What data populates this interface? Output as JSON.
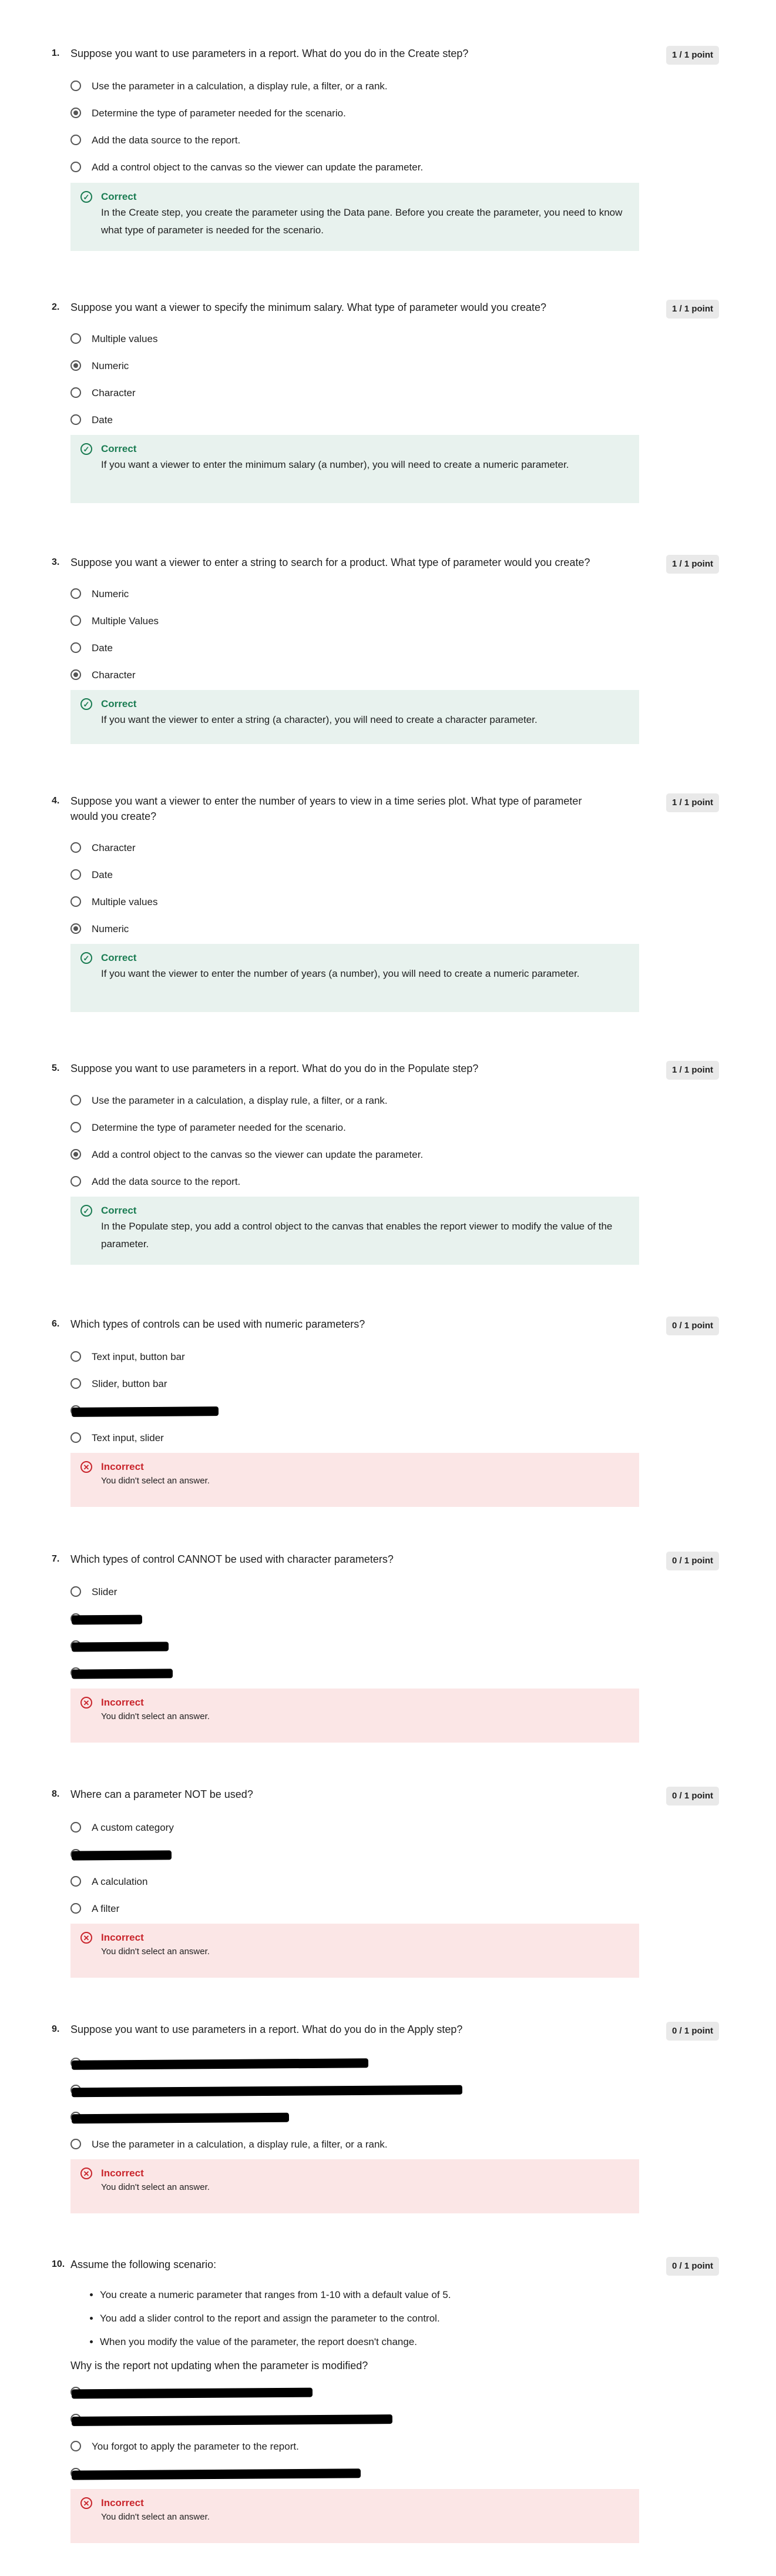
{
  "questions": [
    {
      "number": "1.",
      "text": "Suppose you want to use parameters in a report. What do you do in the Create step?",
      "score": "1 / 1 point",
      "options": [
        {
          "label": "Use the parameter in a calculation, a display rule, a filter, or a rank.",
          "selected": false
        },
        {
          "label": "Determine the type of parameter needed for the scenario.",
          "selected": true
        },
        {
          "label": "Add the data source to the report.",
          "selected": false
        },
        {
          "label": "Add a control object to the canvas so the viewer can update the parameter.",
          "selected": false
        }
      ],
      "feedback": {
        "status": "correct",
        "title": "Correct",
        "text": "In the Create step, you create the parameter using the Data pane. Before you create the parameter, you need to know what type of parameter is needed for the scenario."
      }
    },
    {
      "number": "2.",
      "text": "Suppose you want a viewer to specify the minimum salary. What type of parameter would you create?",
      "score": "1 / 1 point",
      "options": [
        {
          "label": "Multiple values",
          "selected": false
        },
        {
          "label": "Numeric",
          "selected": true
        },
        {
          "label": "Character",
          "selected": false
        },
        {
          "label": "Date",
          "selected": false
        }
      ],
      "feedback": {
        "status": "correct",
        "title": "Correct",
        "text": "If you want a viewer to enter the minimum salary (a number), you will need to create a numeric parameter."
      }
    },
    {
      "number": "3.",
      "text": "Suppose you want a viewer to enter a string to search for a product. What type of parameter would you create?",
      "score": "1 / 1 point",
      "options": [
        {
          "label": "Numeric",
          "selected": false
        },
        {
          "label": "Multiple Values",
          "selected": false
        },
        {
          "label": "Date",
          "selected": false
        },
        {
          "label": "Character",
          "selected": true
        }
      ],
      "feedback": {
        "status": "correct",
        "title": "Correct",
        "text": "If you want the viewer to enter a string (a character), you will need to create a character parameter."
      }
    },
    {
      "number": "4.",
      "text": "Suppose you want a viewer to enter the number of years to view in a time series plot. What type of parameter would you create?",
      "score": "1 / 1 point",
      "options": [
        {
          "label": "Character",
          "selected": false
        },
        {
          "label": "Date",
          "selected": false
        },
        {
          "label": "Multiple values",
          "selected": false
        },
        {
          "label": "Numeric",
          "selected": true
        }
      ],
      "feedback": {
        "status": "correct",
        "title": "Correct",
        "text": "If you want the viewer to enter the number of years (a number), you will need to create a numeric parameter."
      }
    },
    {
      "number": "5.",
      "text": "Suppose you want to use parameters in a report. What do you do in the Populate step?",
      "score": "1 / 1 point",
      "options": [
        {
          "label": "Use the parameter in a calculation, a display rule, a filter, or a rank.",
          "selected": false
        },
        {
          "label": "Determine the type of parameter needed for the scenario.",
          "selected": false
        },
        {
          "label": "Add a control object to the canvas so the viewer can update the parameter.",
          "selected": true
        },
        {
          "label": "Add the data source to the report.",
          "selected": false
        }
      ],
      "feedback": {
        "status": "correct",
        "title": "Correct",
        "text": "In the Populate step, you add a control object to the canvas that enables the report viewer to modify the value of the parameter."
      }
    },
    {
      "number": "6.",
      "text": "Which types of controls can be used with numeric parameters?",
      "score": "0 / 1 point",
      "options": [
        {
          "label": "Text input, button bar",
          "selected": false
        },
        {
          "label": "Slider, button bar",
          "selected": false
        },
        {
          "label": "",
          "selected": false
        },
        {
          "label": "Text input, slider",
          "selected": false
        }
      ],
      "feedback": {
        "status": "incorrect",
        "title": "Incorrect",
        "text": "You didn't select an answer."
      }
    },
    {
      "number": "7.",
      "text": "Which types of control CANNOT be used with character parameters?",
      "score": "0 / 1 point",
      "options": [
        {
          "label": "Slider",
          "selected": false
        },
        {
          "label": "",
          "selected": false
        },
        {
          "label": "",
          "selected": false
        },
        {
          "label": "",
          "selected": false
        }
      ],
      "feedback": {
        "status": "incorrect",
        "title": "Incorrect",
        "text": "You didn't select an answer."
      }
    },
    {
      "number": "8.",
      "text": "Where can a parameter NOT be used?",
      "score": "0 / 1 point",
      "options": [
        {
          "label": "A custom category",
          "selected": false
        },
        {
          "label": "",
          "selected": false
        },
        {
          "label": "A calculation",
          "selected": false
        },
        {
          "label": "A filter",
          "selected": false
        }
      ],
      "feedback": {
        "status": "incorrect",
        "title": "Incorrect",
        "text": "You didn't select an answer."
      }
    },
    {
      "number": "9.",
      "text": "Suppose you want to use parameters in a report. What do you do in the Apply step?",
      "score": "0 / 1 point",
      "options": [
        {
          "label": "",
          "selected": false
        },
        {
          "label": "",
          "selected": false
        },
        {
          "label": "",
          "selected": false
        },
        {
          "label": "Use the parameter in a calculation, a display rule, a filter, or a rank.",
          "selected": false
        }
      ],
      "feedback": {
        "status": "incorrect",
        "title": "Incorrect",
        "text": "You didn't select an answer."
      }
    },
    {
      "number": "10.",
      "text": "Assume the following scenario:",
      "score": "0 / 1 point",
      "bullets": [
        "You create a numeric parameter that ranges from 1-10 with a default value of 5.",
        "You add a slider control to the report and assign the parameter to the control.",
        "When you modify the value of the parameter, the report doesn't change."
      ],
      "subtext": "Why is the report not updating when the parameter is modified?",
      "options": [
        {
          "label": "",
          "selected": false
        },
        {
          "label": "",
          "selected": false
        },
        {
          "label": "You forgot to apply the parameter to the report.",
          "selected": false
        },
        {
          "label": "",
          "selected": false
        }
      ],
      "feedback": {
        "status": "incorrect",
        "title": "Incorrect",
        "text": "You didn't select an answer."
      }
    }
  ]
}
